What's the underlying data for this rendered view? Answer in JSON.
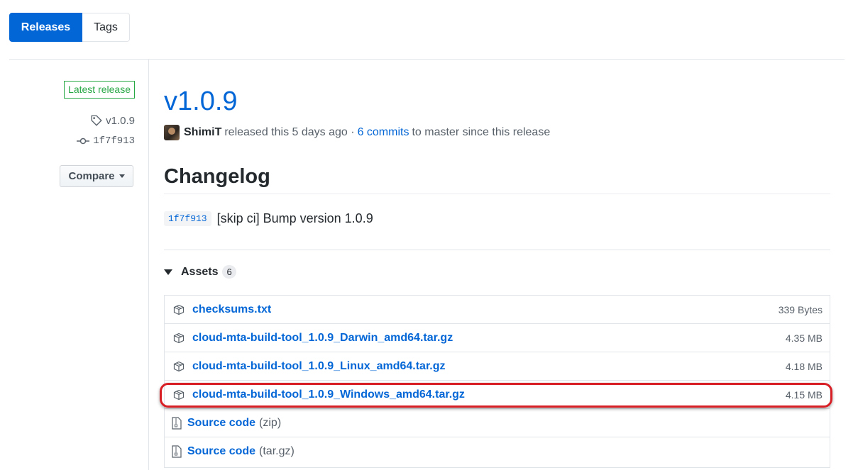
{
  "tabs": [
    {
      "label": "Releases",
      "active": true
    },
    {
      "label": "Tags",
      "active": false
    }
  ],
  "sidebar": {
    "latest_badge": "Latest release",
    "tag": "v1.0.9",
    "commit": "1f7f913",
    "compare_label": "Compare"
  },
  "release": {
    "title": "v1.0.9",
    "author": "ShimiT",
    "released_text": "released this 5 days ago ·",
    "commits_link": "6 commits",
    "since_text": "to master since this release"
  },
  "changelog": {
    "heading": "Changelog",
    "sha": "1f7f913",
    "message": "[skip ci] Bump version 1.0.9"
  },
  "assets": {
    "label": "Assets",
    "count": "6",
    "items": [
      {
        "name": "checksums.txt",
        "size": "339 Bytes",
        "icon": "package-icon"
      },
      {
        "name": "cloud-mta-build-tool_1.0.9_Darwin_amd64.tar.gz",
        "size": "4.35 MB",
        "icon": "package-icon"
      },
      {
        "name": "cloud-mta-build-tool_1.0.9_Linux_amd64.tar.gz",
        "size": "4.18 MB",
        "icon": "package-icon"
      },
      {
        "name": "cloud-mta-build-tool_1.0.9_Windows_amd64.tar.gz",
        "size": "4.15 MB",
        "icon": "package-icon"
      },
      {
        "name": "Source code",
        "suffix": "(zip)",
        "icon": "file-zip-icon"
      },
      {
        "name": "Source code",
        "suffix": "(tar.gz)",
        "icon": "file-zip-icon"
      }
    ]
  },
  "colors": {
    "accent": "#0366d6",
    "highlight": "#d91f26",
    "latest": "#28a745"
  }
}
